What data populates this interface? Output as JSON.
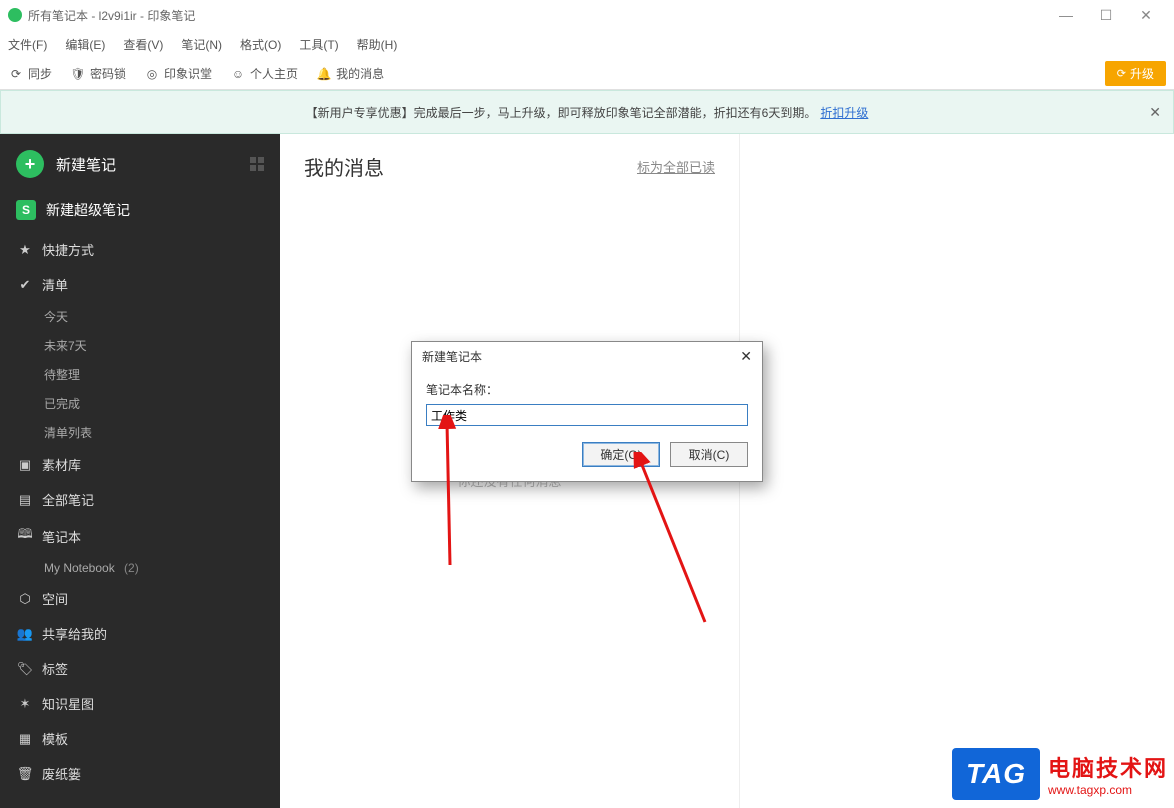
{
  "window": {
    "title": "所有笔记本 - l2v9i1ir - 印象笔记"
  },
  "menu": {
    "file": "文件(F)",
    "edit": "编辑(E)",
    "view": "查看(V)",
    "note": "笔记(N)",
    "format": "格式(O)",
    "tools": "工具(T)",
    "help": "帮助(H)"
  },
  "toolbar": {
    "sync": "同步",
    "lock": "密码锁",
    "classroom": "印象识堂",
    "profile": "个人主页",
    "messages": "我的消息",
    "upgrade": "升级"
  },
  "promo": {
    "text": "【新用户专享优惠】完成最后一步，马上升级，即可释放印象笔记全部潜能，折扣还有6天到期。",
    "link": "折扣升级"
  },
  "sidebar": {
    "new_note": "新建笔记",
    "super_note": "新建超级笔记",
    "super_badge": "S",
    "shortcut": "快捷方式",
    "checklist": "清单",
    "todo_today": "今天",
    "todo_week": "未来7天",
    "todo_pending": "待整理",
    "todo_done": "已完成",
    "todo_list": "清单列表",
    "material": "素材库",
    "all_notes": "全部笔记",
    "notebooks": "笔记本",
    "my_notebook": "My Notebook",
    "my_notebook_count": "(2)",
    "space": "空间",
    "shared": "共享给我的",
    "tags": "标签",
    "knowledge": "知识星图",
    "templates": "模板",
    "trash": "废纸篓"
  },
  "messages": {
    "title": "我的消息",
    "mark_all": "标为全部已读",
    "empty": "你还没有任何消息"
  },
  "dialog": {
    "title": "新建笔记本",
    "label": "笔记本名称：",
    "value": "工作类",
    "ok": "确定(O)",
    "cancel": "取消(C)"
  },
  "watermark": {
    "tag": "TAG",
    "line1": "电脑技术网",
    "line2": "www.tagxp.com"
  }
}
